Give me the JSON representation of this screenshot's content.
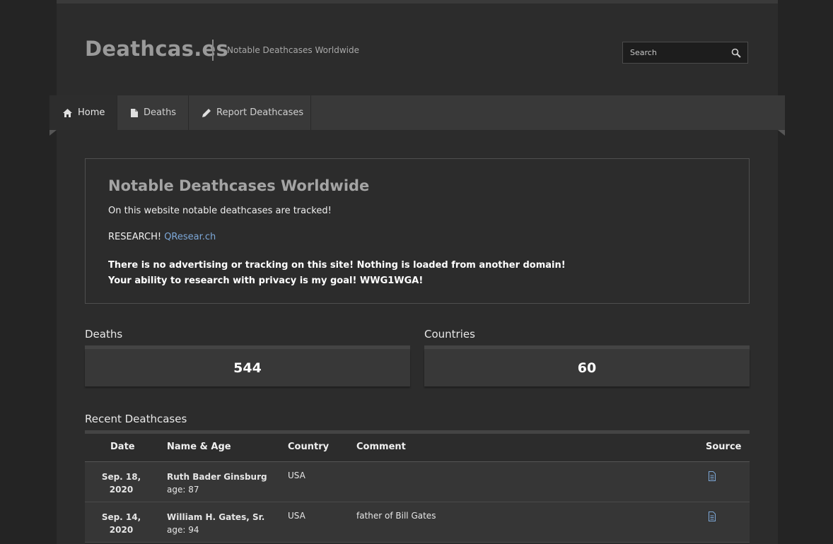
{
  "site": {
    "logo": "Deathcas.es",
    "tagline": "Notable Deathcases Worldwide",
    "search_placeholder": "Search"
  },
  "nav": {
    "items": [
      {
        "label": "Home",
        "icon": "home-icon",
        "active": true
      },
      {
        "label": "Deaths",
        "icon": "document-icon",
        "active": false
      },
      {
        "label": "Report Deathcases",
        "icon": "pencil-icon",
        "active": false
      }
    ]
  },
  "intro": {
    "title": "Notable Deathcases Worldwide",
    "line1": "On this website notable deathcases are tracked!",
    "research_prefix": "RESEARCH!",
    "research_link": "QResear.ch",
    "bold_line1": "There is no advertising or tracking on this site! Nothing is loaded from another domain!",
    "bold_line2": "Your ability to research with privacy is my goal! WWG1WGA!"
  },
  "stats": {
    "deaths_label": "Deaths",
    "deaths_value": "544",
    "countries_label": "Countries",
    "countries_value": "60"
  },
  "recent": {
    "title": "Recent Deathcases",
    "columns": {
      "date": "Date",
      "name": "Name & Age",
      "country": "Country",
      "comment": "Comment",
      "source": "Source"
    },
    "rows": [
      {
        "date_l1": "Sep. 18,",
        "date_l2": "2020",
        "name": "Ruth Bader Ginsburg",
        "age": "age: 87",
        "country": "USA",
        "comment": ""
      },
      {
        "date_l1": "Sep. 14,",
        "date_l2": "2020",
        "name": "William H. Gates, Sr.",
        "age": "age: 94",
        "country": "USA",
        "comment": "father of Bill Gates"
      }
    ]
  },
  "colors": {
    "link": "#7da8d8",
    "background": "#242424",
    "panel": "#2c2c2c"
  }
}
